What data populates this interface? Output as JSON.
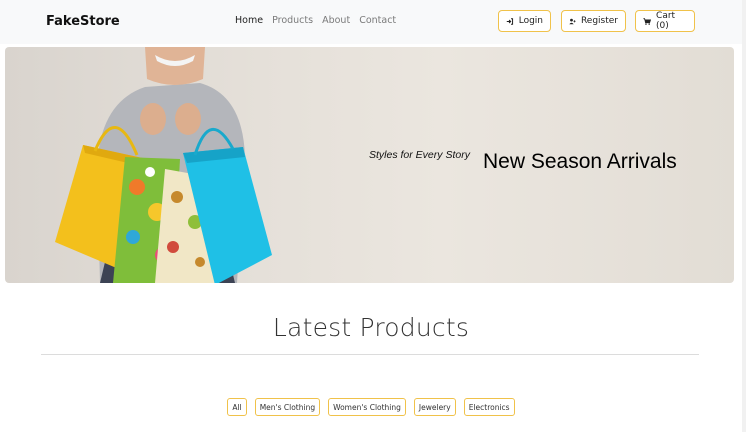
{
  "navbar": {
    "brand": "FakeStore",
    "links": [
      {
        "label": "Home",
        "active": true
      },
      {
        "label": "Products",
        "active": false
      },
      {
        "label": "About",
        "active": false
      },
      {
        "label": "Contact",
        "active": false
      }
    ],
    "buttons": {
      "login": {
        "label": "Login",
        "icon": "sign-in-icon"
      },
      "register": {
        "label": "Register",
        "icon": "user-plus-icon"
      },
      "cart": {
        "label": "Cart (0)",
        "icon": "cart-icon"
      }
    },
    "accent_color": "#f0c24a"
  },
  "hero": {
    "subtitle": "Styles for Every Story",
    "title": "New Season Arrivals"
  },
  "products_section": {
    "title": "Latest Products",
    "filters": [
      "All",
      "Men's Clothing",
      "Women's Clothing",
      "Jewelery",
      "Electronics"
    ]
  }
}
